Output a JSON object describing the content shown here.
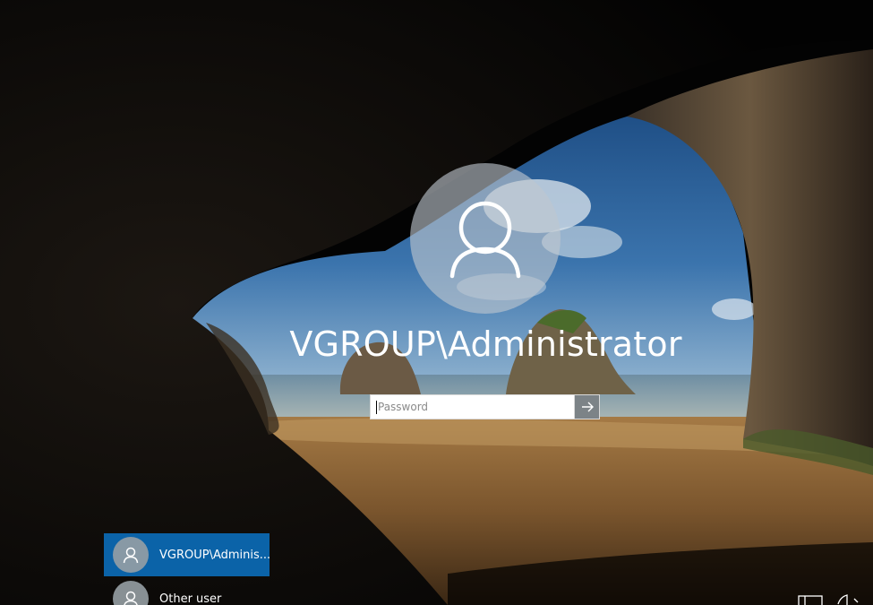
{
  "login": {
    "username": "VGROUP\\Administrator",
    "password_placeholder": "Password",
    "password_value": ""
  },
  "user_list": [
    {
      "label": "VGROUP\\Adminis...",
      "selected": true
    },
    {
      "label": "Other user",
      "selected": false
    }
  ],
  "icons": {
    "avatar": "user-icon",
    "submit": "arrow-right-icon",
    "network": "network-icon",
    "accessibility": "ease-of-access-icon"
  },
  "colors": {
    "selected_tile": "#0b63a8",
    "text": "#ffffff"
  }
}
